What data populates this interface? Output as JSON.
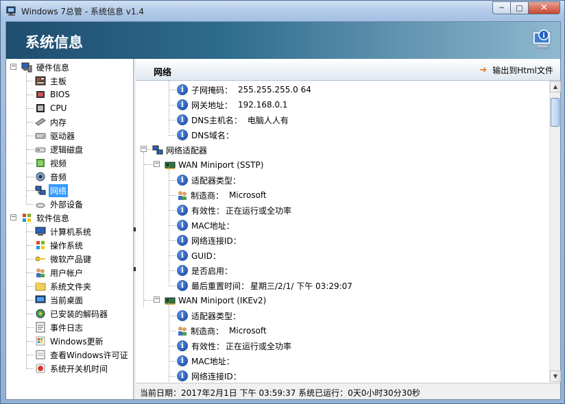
{
  "window": {
    "title": "Windows 7总管 - 系统信息 v1.4",
    "min_label": "─",
    "max_label": "□",
    "close_label": "✕"
  },
  "banner": {
    "title": "系统信息"
  },
  "tree": {
    "hardware": {
      "label": "硬件信息",
      "expander": "−"
    },
    "hardware_items": [
      "主板",
      "BIOS",
      "CPU",
      "内存",
      "驱动器",
      "逻辑磁盘",
      "视频",
      "音频",
      "网络",
      "外部设备"
    ],
    "software": {
      "label": "软件信息",
      "expander": "−"
    },
    "software_items": [
      "计算机系统",
      "操作系统",
      "微软产品键",
      "用户帐户",
      "系统文件夹",
      "当前桌面",
      "已安装的解码器",
      "事件日志",
      "Windows更新",
      "查看Windows许可证",
      "系统开关机时间"
    ],
    "selected": "网络"
  },
  "header": {
    "title": "网络",
    "export_label": "输出到Html文件"
  },
  "details": {
    "top_rows": [
      {
        "key": "子网掩码：",
        "value": "255.255.255.0 64"
      },
      {
        "key": "网关地址：",
        "value": "192.168.0.1"
      },
      {
        "key": "DNS主机名：",
        "value": "电脑人人有"
      },
      {
        "key": "DNS域名：",
        "value": ""
      }
    ],
    "adapters_group": "网络适配器",
    "adapter1": {
      "name": "WAN Miniport (SSTP)",
      "rows": [
        {
          "key": "适配器类型：",
          "value": ""
        },
        {
          "key": "制造商：",
          "value": "Microsoft"
        },
        {
          "key": "有效性：",
          "value": "正在运行或全功率"
        },
        {
          "key": "MAC地址：",
          "value": ""
        },
        {
          "key": "网络连接ID：",
          "value": ""
        },
        {
          "key": "GUID：",
          "value": ""
        },
        {
          "key": "是否启用：",
          "value": ""
        },
        {
          "key": "最后重置时间：",
          "value": "星期三/2/1/ 下午 03:29:07"
        }
      ]
    },
    "adapter2": {
      "name": "WAN Miniport (IKEv2)",
      "rows": [
        {
          "key": "适配器类型：",
          "value": ""
        },
        {
          "key": "制造商：",
          "value": "Microsoft"
        },
        {
          "key": "有效性：",
          "value": "正在运行或全功率"
        },
        {
          "key": "MAC地址：",
          "value": ""
        },
        {
          "key": "网络连接ID：",
          "value": ""
        }
      ]
    }
  },
  "status": {
    "text": "当前日期：2017年2月1日   下午 03:59:37   系统已运行：0天0小时30分30秒"
  },
  "scroll": {
    "up": "▲",
    "down": "▼"
  },
  "icons": {
    "app": "monitor-icon",
    "info": "info-icon",
    "accent": "#3399ff",
    "banner_dark": "#1e4d6f"
  }
}
